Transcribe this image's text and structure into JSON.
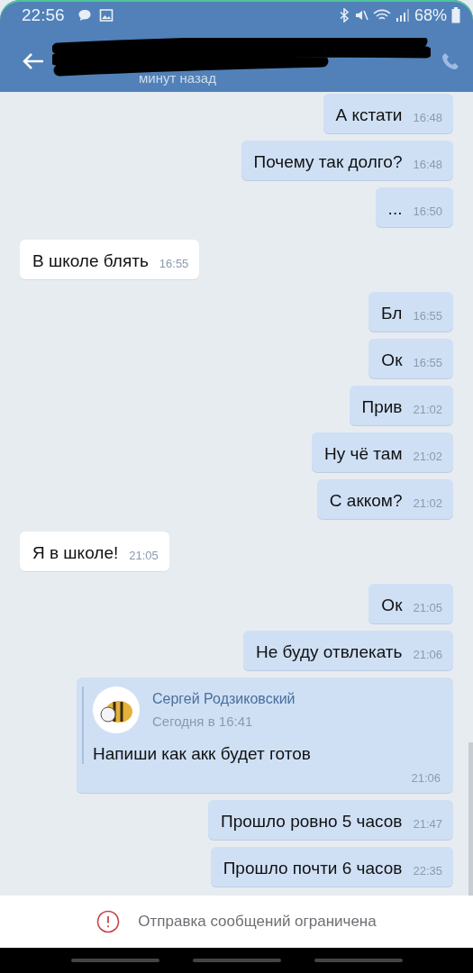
{
  "status_bar": {
    "time": "22:56",
    "battery": "68%"
  },
  "header": {
    "subtitle": "минут назад"
  },
  "messages": [
    {
      "kind": "outgoing",
      "text": "А кстати",
      "time": "16:48"
    },
    {
      "kind": "outgoing",
      "text": "Почему так долго?",
      "time": "16:48"
    },
    {
      "kind": "outgoing",
      "text": "...",
      "time": "16:50"
    },
    {
      "kind": "incoming",
      "text": "В школе блять",
      "time": "16:55"
    },
    {
      "kind": "outgoing",
      "text": "Бл",
      "time": "16:55"
    },
    {
      "kind": "outgoing",
      "text": "Ок",
      "time": "16:55"
    },
    {
      "kind": "outgoing",
      "text": "Прив",
      "time": "21:02"
    },
    {
      "kind": "outgoing",
      "text": "Ну чё там",
      "time": "21:02"
    },
    {
      "kind": "outgoing",
      "text": "С акком?",
      "time": "21:02"
    },
    {
      "kind": "incoming",
      "text": "Я в школе!",
      "time": "21:05"
    },
    {
      "kind": "outgoing",
      "text": "Ок",
      "time": "21:05"
    },
    {
      "kind": "outgoing",
      "text": "Не буду отвлекать",
      "time": "21:06"
    },
    {
      "kind": "forward",
      "quote": {
        "author": "Сергей Родзиковский",
        "date": "Сегодня в 16:41",
        "text": "Напиши как акк будет готов"
      },
      "time": "21:06"
    },
    {
      "kind": "outgoing",
      "text": "Прошло ровно 5 часов",
      "time": "21:47"
    },
    {
      "kind": "outgoing",
      "text": "Прошло почти 6 часов",
      "time": "22:35"
    }
  ],
  "notice": {
    "text": "Отправка сообщений ограничена"
  }
}
